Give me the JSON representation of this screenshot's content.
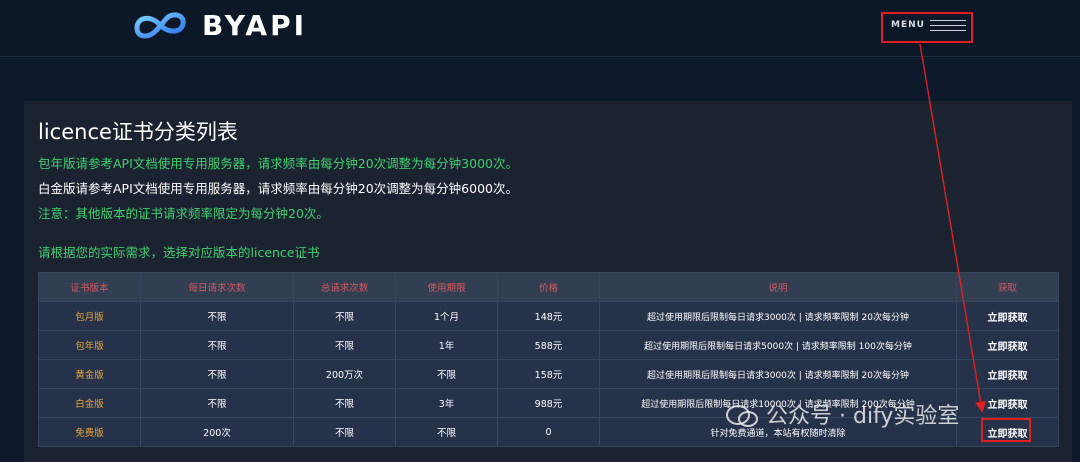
{
  "header": {
    "brand": "BYAPI",
    "menu_label": "MENU"
  },
  "content": {
    "title": "licence证书分类列表",
    "notes": [
      "包年版请参考API文档使用专用服务器，请求频率由每分钟20次调整为每分钟3000次。",
      "白金版请参考API文档使用专用服务器，请求频率由每分钟20次调整为每分钟6000次。",
      "注意：其他版本的证书请求频率限定为每分钟20次。",
      "请根据您的实际需求，选择对应版本的licence证书"
    ]
  },
  "table": {
    "headers": [
      "证书版本",
      "每日请求次数",
      "总请求次数",
      "使用期限",
      "价格",
      "说明",
      "获取"
    ],
    "rows": [
      [
        "包月版",
        "不限",
        "不限",
        "1个月",
        "148元",
        "超过使用期限后限制每日请求3000次 | 请求频率限制 20次每分钟",
        "立即获取"
      ],
      [
        "包年版",
        "不限",
        "不限",
        "1年",
        "588元",
        "超过使用期限后限制每日请求5000次 | 请求频率限制 100次每分钟",
        "立即获取"
      ],
      [
        "黄金版",
        "不限",
        "200万次",
        "不限",
        "158元",
        "超过使用期限后限制每日请求3000次 | 请求频率限制 20次每分钟",
        "立即获取"
      ],
      [
        "白金版",
        "不限",
        "不限",
        "3年",
        "988元",
        "超过使用期限后限制每日请求10000次 | 请求频率限制 200次每分钟",
        "立即获取"
      ],
      [
        "免费版",
        "200次",
        "不限",
        "不限",
        "0",
        "针对免费通道，本站有权随时清除",
        "立即获取"
      ]
    ]
  },
  "watermark": "公众号 · dify实验室",
  "colors": {
    "accent_green": "#3fd06e",
    "header_red": "#d5575e",
    "version_orange": "#e8a33d",
    "annotation_red": "#e02020"
  }
}
